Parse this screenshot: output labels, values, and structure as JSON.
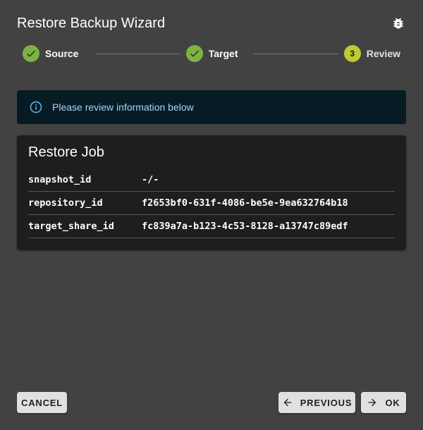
{
  "dialog": {
    "title": "Restore Backup Wizard",
    "bug_icon": "bug-icon"
  },
  "stepper": {
    "steps": [
      {
        "label": "Source",
        "state": "completed",
        "icon": "check-icon"
      },
      {
        "label": "Target",
        "state": "completed",
        "icon": "check-icon"
      },
      {
        "label": "Review",
        "state": "active",
        "number": "3"
      }
    ]
  },
  "alert": {
    "icon": "info-icon",
    "text": "Please review information below"
  },
  "card": {
    "title": "Restore Job",
    "rows": [
      {
        "key": "snapshot_id",
        "value": "-/-"
      },
      {
        "key": "repository_id",
        "value": "f2653bf0-631f-4086-be5e-9ea632764b18"
      },
      {
        "key": "target_share_id",
        "value": "fc839a7a-b123-4c53-8128-a13747c89edf"
      }
    ]
  },
  "footer": {
    "cancel_label": "CANCEL",
    "previous_label": "PREVIOUS",
    "ok_label": "OK",
    "previous_icon": "arrow-left-icon",
    "ok_icon": "arrow-right-icon"
  },
  "colors": {
    "background": "#424242",
    "step_complete": "#7cb342",
    "step_active": "#c0ca33",
    "alert_bg": "#061b24",
    "alert_text": "#a6d5fa",
    "card_bg": "#1e1e1e",
    "button_bg": "#e0e0e0"
  }
}
